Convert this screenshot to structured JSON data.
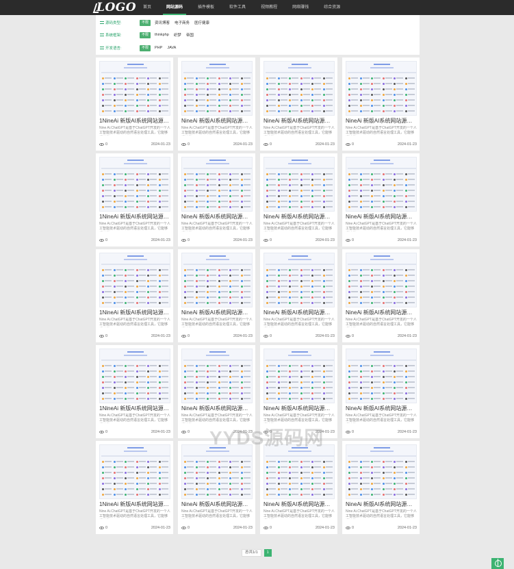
{
  "header": {
    "logo": "LOGO",
    "nav": [
      "首页",
      "网站源码",
      "插件模板",
      "软件工具",
      "视频教程",
      "网络赚钱",
      "综合资源"
    ],
    "active_index": 1
  },
  "filters": [
    {
      "label": "源码类型:",
      "tag": "不限",
      "options": [
        "资讯博客",
        "电子商务",
        "医疗健康"
      ]
    },
    {
      "label": "系统框架:",
      "tag": "不限",
      "options": [
        "thinkphp",
        "织梦",
        "帝国"
      ]
    },
    {
      "label": "开发语言:",
      "tag": "不限",
      "options": [
        "PHP",
        "JAVA"
      ]
    }
  ],
  "cards": [
    {
      "title": "1NineAi 新版AI系统网站源码 ChatGPT",
      "desc": "Nine Ai.ChatGPT是基于ChatGPT开发的一个人工智能技术驱动的自然语言处理工具，它能够通过学",
      "views": "0",
      "date": "2024-01-23"
    },
    {
      "title": "NineAi 新版AI系统网站源码 ChatGPT",
      "desc": "Nine Ai.ChatGPT是基于ChatGPT开发的一个人工智能技术驱动的自然语言处理工具，它能够通过学",
      "views": "0",
      "date": "2024-01-23"
    },
    {
      "title": "NineAi 新版AI系统网站源码 ChatGPT",
      "desc": "Nine Ai.ChatGPT是基于ChatGPT开发的一个人工智能技术驱动的自然语言处理工具，它能够通过学",
      "views": "0",
      "date": "2024-01-23"
    },
    {
      "title": "NineAi 新版AI系统网站源码 ChatGPT",
      "desc": "Nine Ai.ChatGPT是基于ChatGPT开发的一个人工智能技术驱动的自然语言处理工具，它能够通过学",
      "views": "0",
      "date": "2024-01-23"
    },
    {
      "title": "1NineAi 新版AI系统网站源码 ChatGPT",
      "desc": "Nine Ai.ChatGPT是基于ChatGPT开发的一个人工智能技术驱动的自然语言处理工具，它能够通过学",
      "views": "0",
      "date": "2024-01-23"
    },
    {
      "title": "NineAi 新版AI系统网站源码 ChatGPT",
      "desc": "Nine Ai.ChatGPT是基于ChatGPT开发的一个人工智能技术驱动的自然语言处理工具，它能够通过学",
      "views": "0",
      "date": "2024-01-23"
    },
    {
      "title": "NineAi 新版AI系统网站源码 ChatGPT",
      "desc": "Nine Ai.ChatGPT是基于ChatGPT开发的一个人工智能技术驱动的自然语言处理工具，它能够通过学",
      "views": "0",
      "date": "2024-01-23"
    },
    {
      "title": "NineAi 新版AI系统网站源码 ChatGPT",
      "desc": "Nine Ai.ChatGPT是基于ChatGPT开发的一个人工智能技术驱动的自然语言处理工具，它能够通过学",
      "views": "0",
      "date": "2024-01-23"
    },
    {
      "title": "1NineAi 新版AI系统网站源码 ChatGPT",
      "desc": "Nine Ai.ChatGPT是基于ChatGPT开发的一个人工智能技术驱动的自然语言处理工具，它能够通过学",
      "views": "0",
      "date": "2024-01-23"
    },
    {
      "title": "NineAi 新版AI系统网站源码 ChatGPT",
      "desc": "Nine Ai.ChatGPT是基于ChatGPT开发的一个人工智能技术驱动的自然语言处理工具，它能够通过学",
      "views": "0",
      "date": "2024-01-23"
    },
    {
      "title": "NineAi 新版AI系统网站源码 ChatGPT",
      "desc": "Nine Ai.ChatGPT是基于ChatGPT开发的一个人工智能技术驱动的自然语言处理工具，它能够通过学",
      "views": "0",
      "date": "2024-01-23"
    },
    {
      "title": "NineAi 新版AI系统网站源码 ChatGPT",
      "desc": "Nine Ai.ChatGPT是基于ChatGPT开发的一个人工智能技术驱动的自然语言处理工具，它能够通过学",
      "views": "0",
      "date": "2024-01-23"
    },
    {
      "title": "1NineAi 新版AI系统网站源码 ChatGPT",
      "desc": "Nine Ai.ChatGPT是基于ChatGPT开发的一个人工智能技术驱动的自然语言处理工具，它能够通过学",
      "views": "0",
      "date": "2024-01-23"
    },
    {
      "title": "NineAi 新版AI系统网站源码 ChatGPT",
      "desc": "Nine Ai.ChatGPT是基于ChatGPT开发的一个人工智能技术驱动的自然语言处理工具，它能够通过学",
      "views": "0",
      "date": "2024-01-23"
    },
    {
      "title": "NineAi 新版AI系统网站源码 ChatGPT",
      "desc": "Nine Ai.ChatGPT是基于ChatGPT开发的一个人工智能技术驱动的自然语言处理工具，它能够通过学",
      "views": "0",
      "date": "2024-01-23"
    },
    {
      "title": "NineAi 新版AI系统网站源码 ChatGPT",
      "desc": "Nine Ai.ChatGPT是基于ChatGPT开发的一个人工智能技术驱动的自然语言处理工具，它能够通过学",
      "views": "0",
      "date": "2024-01-23"
    },
    {
      "title": "1NineAi 新版AI系统网站源码 ChatGPT",
      "desc": "Nine Ai.ChatGPT是基于ChatGPT开发的一个人工智能技术驱动的自然语言处理工具，它能够通过学",
      "views": "0",
      "date": "2024-01-23"
    },
    {
      "title": "NineAi 新版AI系统网站源码 ChatGPT",
      "desc": "Nine Ai.ChatGPT是基于ChatGPT开发的一个人工智能技术驱动的自然语言处理工具，它能够通过学",
      "views": "0",
      "date": "2024-01-23"
    },
    {
      "title": "NineAi 新版AI系统网站源码 ChatGPT",
      "desc": "Nine Ai.ChatGPT是基于ChatGPT开发的一个人工智能技术驱动的自然语言处理工具，它能够通过学",
      "views": "0",
      "date": "2024-01-23"
    },
    {
      "title": "NineAi 新版AI系统网站源码 ChatGPT",
      "desc": "Nine Ai.ChatGPT是基于ChatGPT开发的一个人工智能技术驱动的自然语言处理工具，它能够通过学",
      "views": "0",
      "date": "2024-01-23"
    }
  ],
  "pagination": {
    "info": "总共1/1",
    "current": "1"
  },
  "watermark": "YYDS源码网",
  "colors": {
    "accent": "#3cb371",
    "header_bg": "#2b2b2b",
    "page_bg": "#e9e9e9"
  }
}
